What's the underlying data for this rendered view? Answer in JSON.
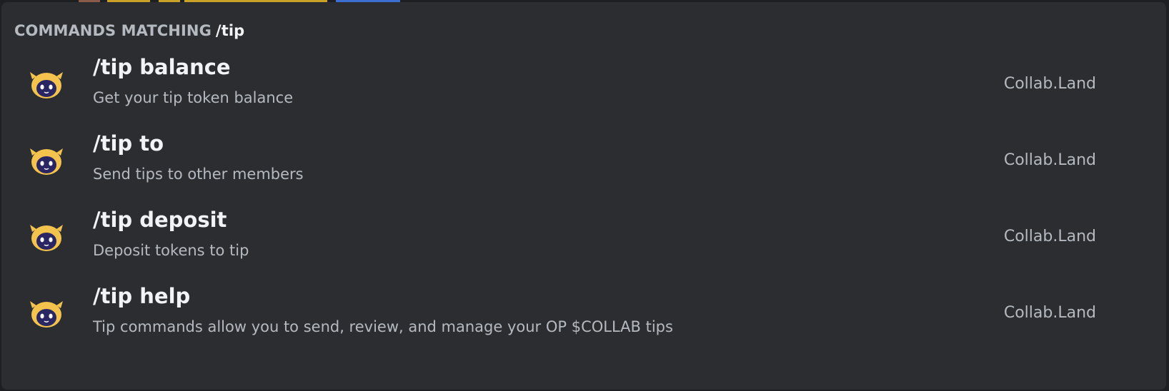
{
  "header": {
    "label": "COMMANDS MATCHING",
    "query": "/tip"
  },
  "colors": {
    "panel_bg": "#2b2d31",
    "text_primary": "#f2f3f5",
    "text_muted": "#b5bac1",
    "avatar_yellow": "#f3c34d",
    "avatar_face": "#2a2563"
  },
  "commands": [
    {
      "name": "/tip balance",
      "description": "Get your tip token balance",
      "source": "Collab.Land",
      "icon": "collab-land-bot-icon"
    },
    {
      "name": "/tip to",
      "description": "Send tips to other members",
      "source": "Collab.Land",
      "icon": "collab-land-bot-icon"
    },
    {
      "name": "/tip deposit",
      "description": "Deposit tokens to tip",
      "source": "Collab.Land",
      "icon": "collab-land-bot-icon"
    },
    {
      "name": "/tip help",
      "description": "Tip commands allow you to send, review, and manage your OP $COLLAB tips",
      "source": "Collab.Land",
      "icon": "collab-land-bot-icon"
    }
  ]
}
